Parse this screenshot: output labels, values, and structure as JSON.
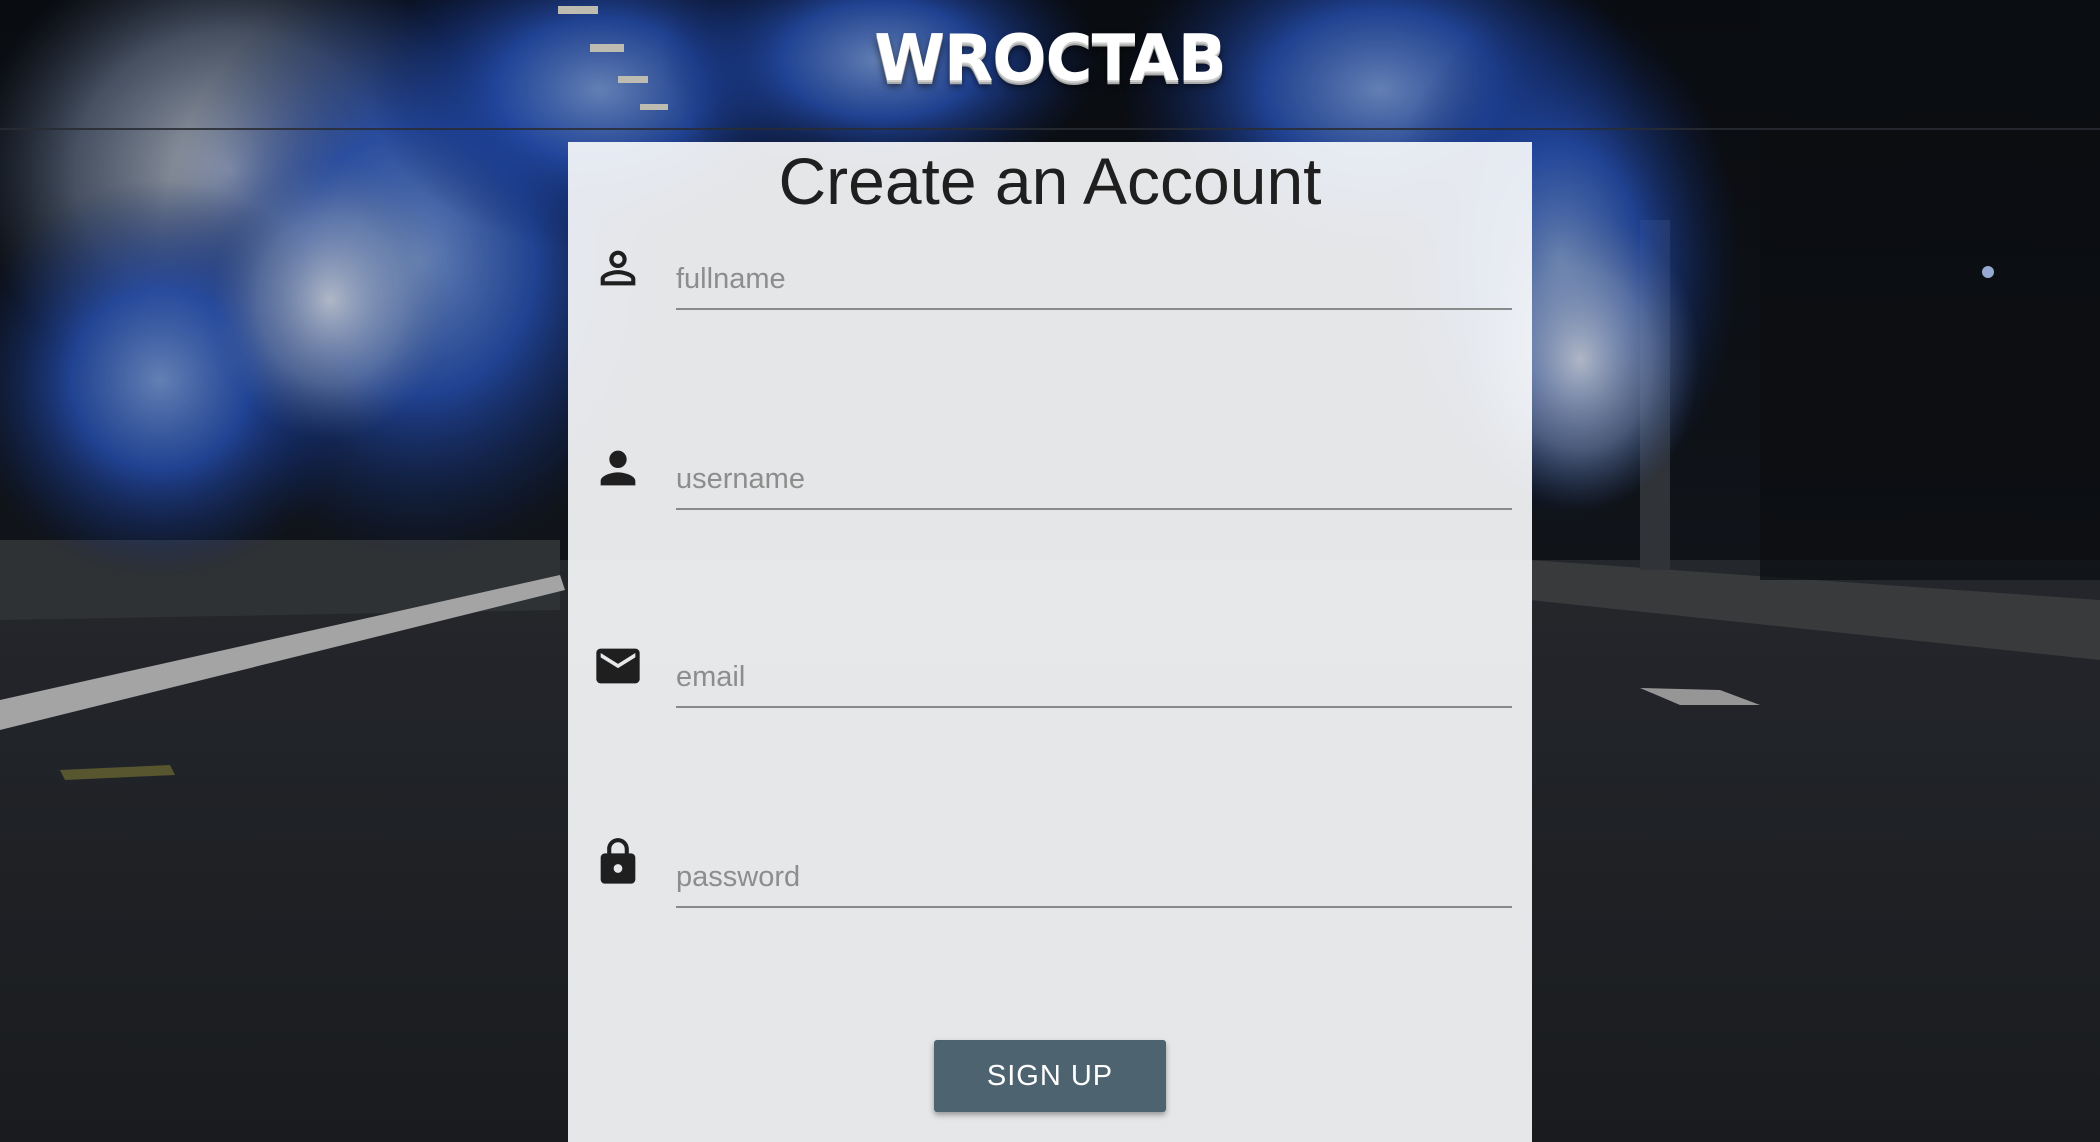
{
  "header": {
    "brand": "WROCTAB"
  },
  "form": {
    "title": "Create an Account",
    "fields": [
      {
        "icon": "person-outline-icon",
        "placeholder": "fullname",
        "value": ""
      },
      {
        "icon": "person-icon",
        "placeholder": "username",
        "value": ""
      },
      {
        "icon": "envelope-icon",
        "placeholder": "email",
        "value": ""
      },
      {
        "icon": "lock-icon",
        "placeholder": "password",
        "value": ""
      }
    ],
    "submit_label": "SIGN UP"
  },
  "colors": {
    "button_bg": "#4d6470",
    "button_text": "#ffffff",
    "card_bg": "#f7f8fa",
    "smoke_accent": "#2a58c4"
  }
}
